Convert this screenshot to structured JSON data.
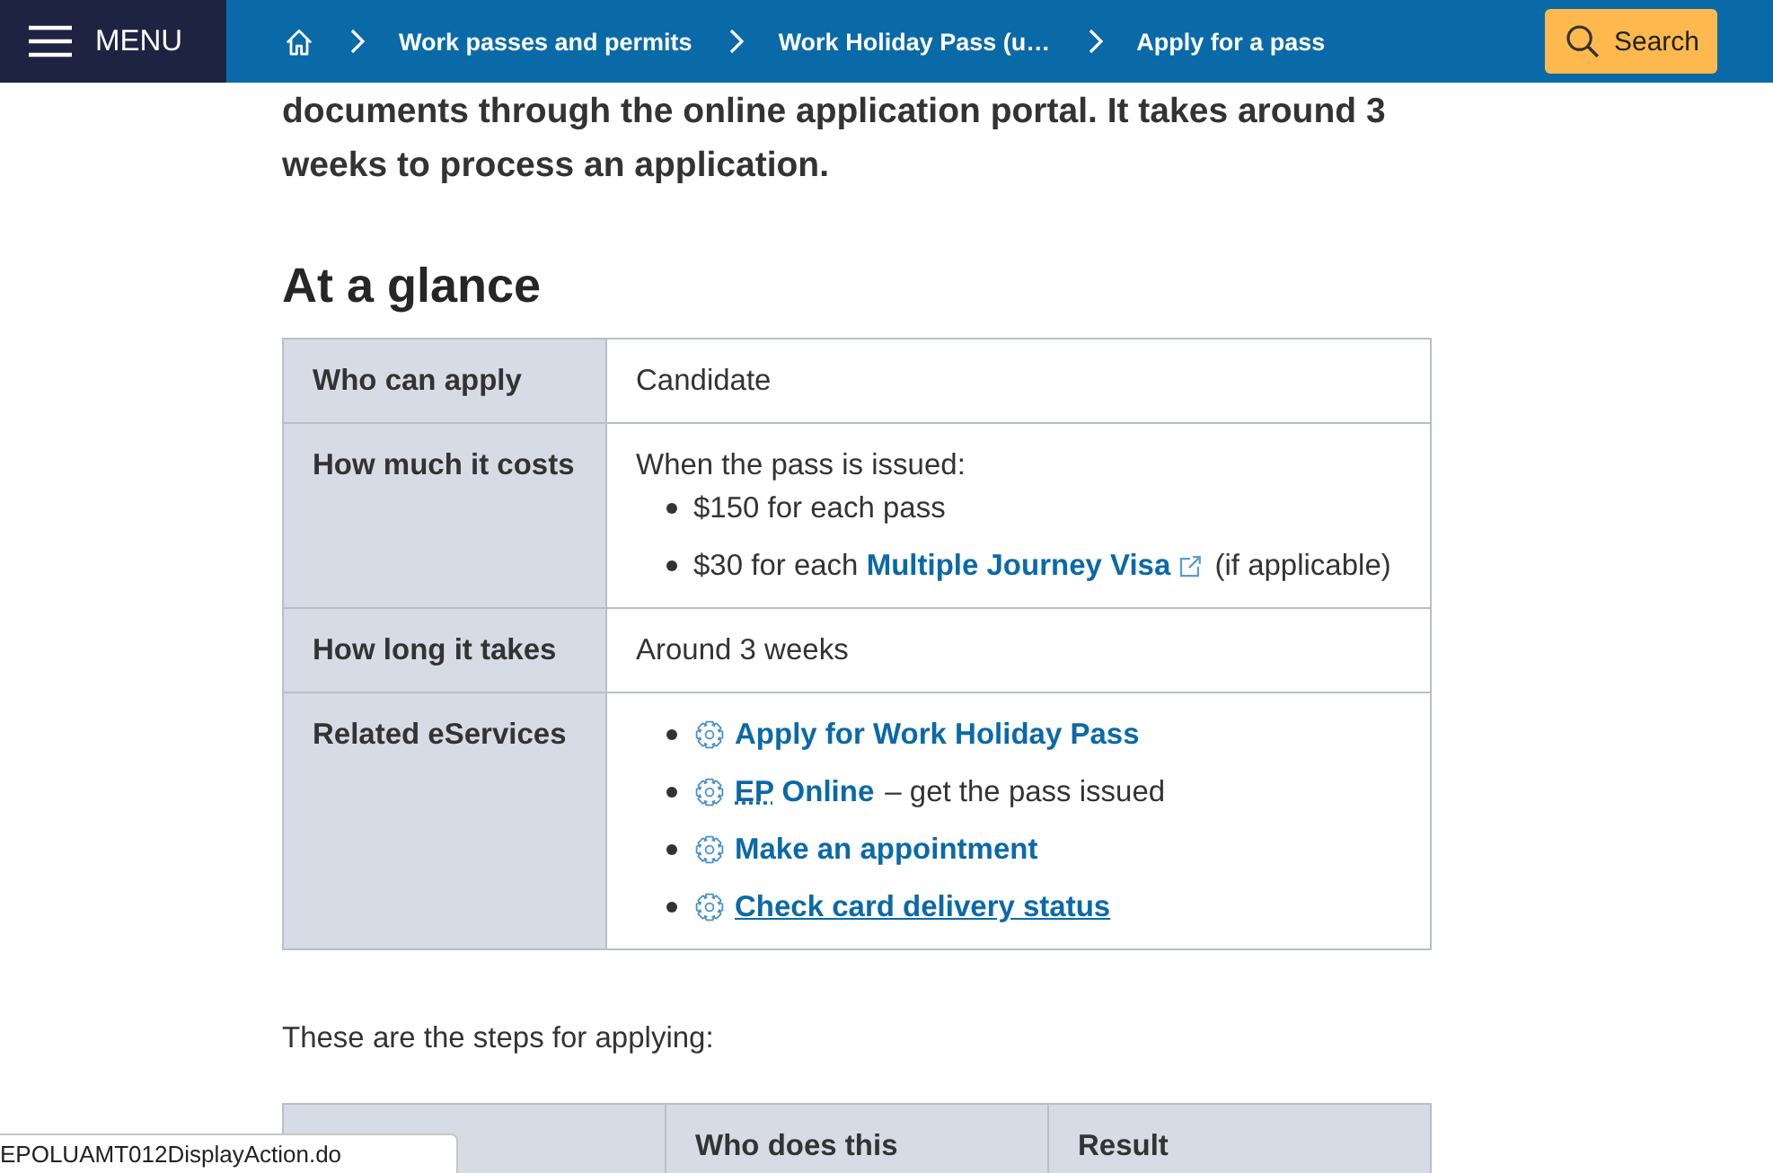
{
  "header": {
    "menu": {
      "label": "MENU"
    },
    "breadcrumb": [
      {
        "label": "Work passes and permits"
      },
      {
        "label": "Work Holiday Pass (u…"
      },
      {
        "label": "Apply for a pass"
      }
    ],
    "search_button": {
      "label": "Search"
    }
  },
  "intro": "documents through the online application portal. It takes around 3 weeks to process an application.",
  "glance": {
    "heading": "At a glance",
    "rows": [
      {
        "label": "Who can apply",
        "kind": "text",
        "value": "Candidate"
      },
      {
        "label": "How much it costs",
        "kind": "costs",
        "intro": "When the pass is issued:",
        "items": [
          {
            "text": "$150 for each pass"
          },
          {
            "text": "$30 for each",
            "link": "Multiple Journey Visa",
            "external": true,
            "after": "(if applicable)"
          }
        ]
      },
      {
        "label": "How long it takes",
        "kind": "text",
        "value": "Around 3 weeks"
      },
      {
        "label": "Related eServices",
        "kind": "eservices",
        "items": [
          {
            "link": "Apply for Work Holiday Pass",
            "hovered": false
          },
          {
            "abbr": "EP",
            "link": "Online",
            "note": "– get the pass issued",
            "hovered": false
          },
          {
            "link": "Make an appointment",
            "hovered": false
          },
          {
            "link": "Check card delivery status",
            "hovered": true
          }
        ]
      }
    ]
  },
  "steps": {
    "lead": "These are the steps for applying:",
    "columns": [
      "Who does this",
      "Result"
    ]
  },
  "status_bar": {
    "url": "EPOLUAMT012DisplayAction.do"
  }
}
